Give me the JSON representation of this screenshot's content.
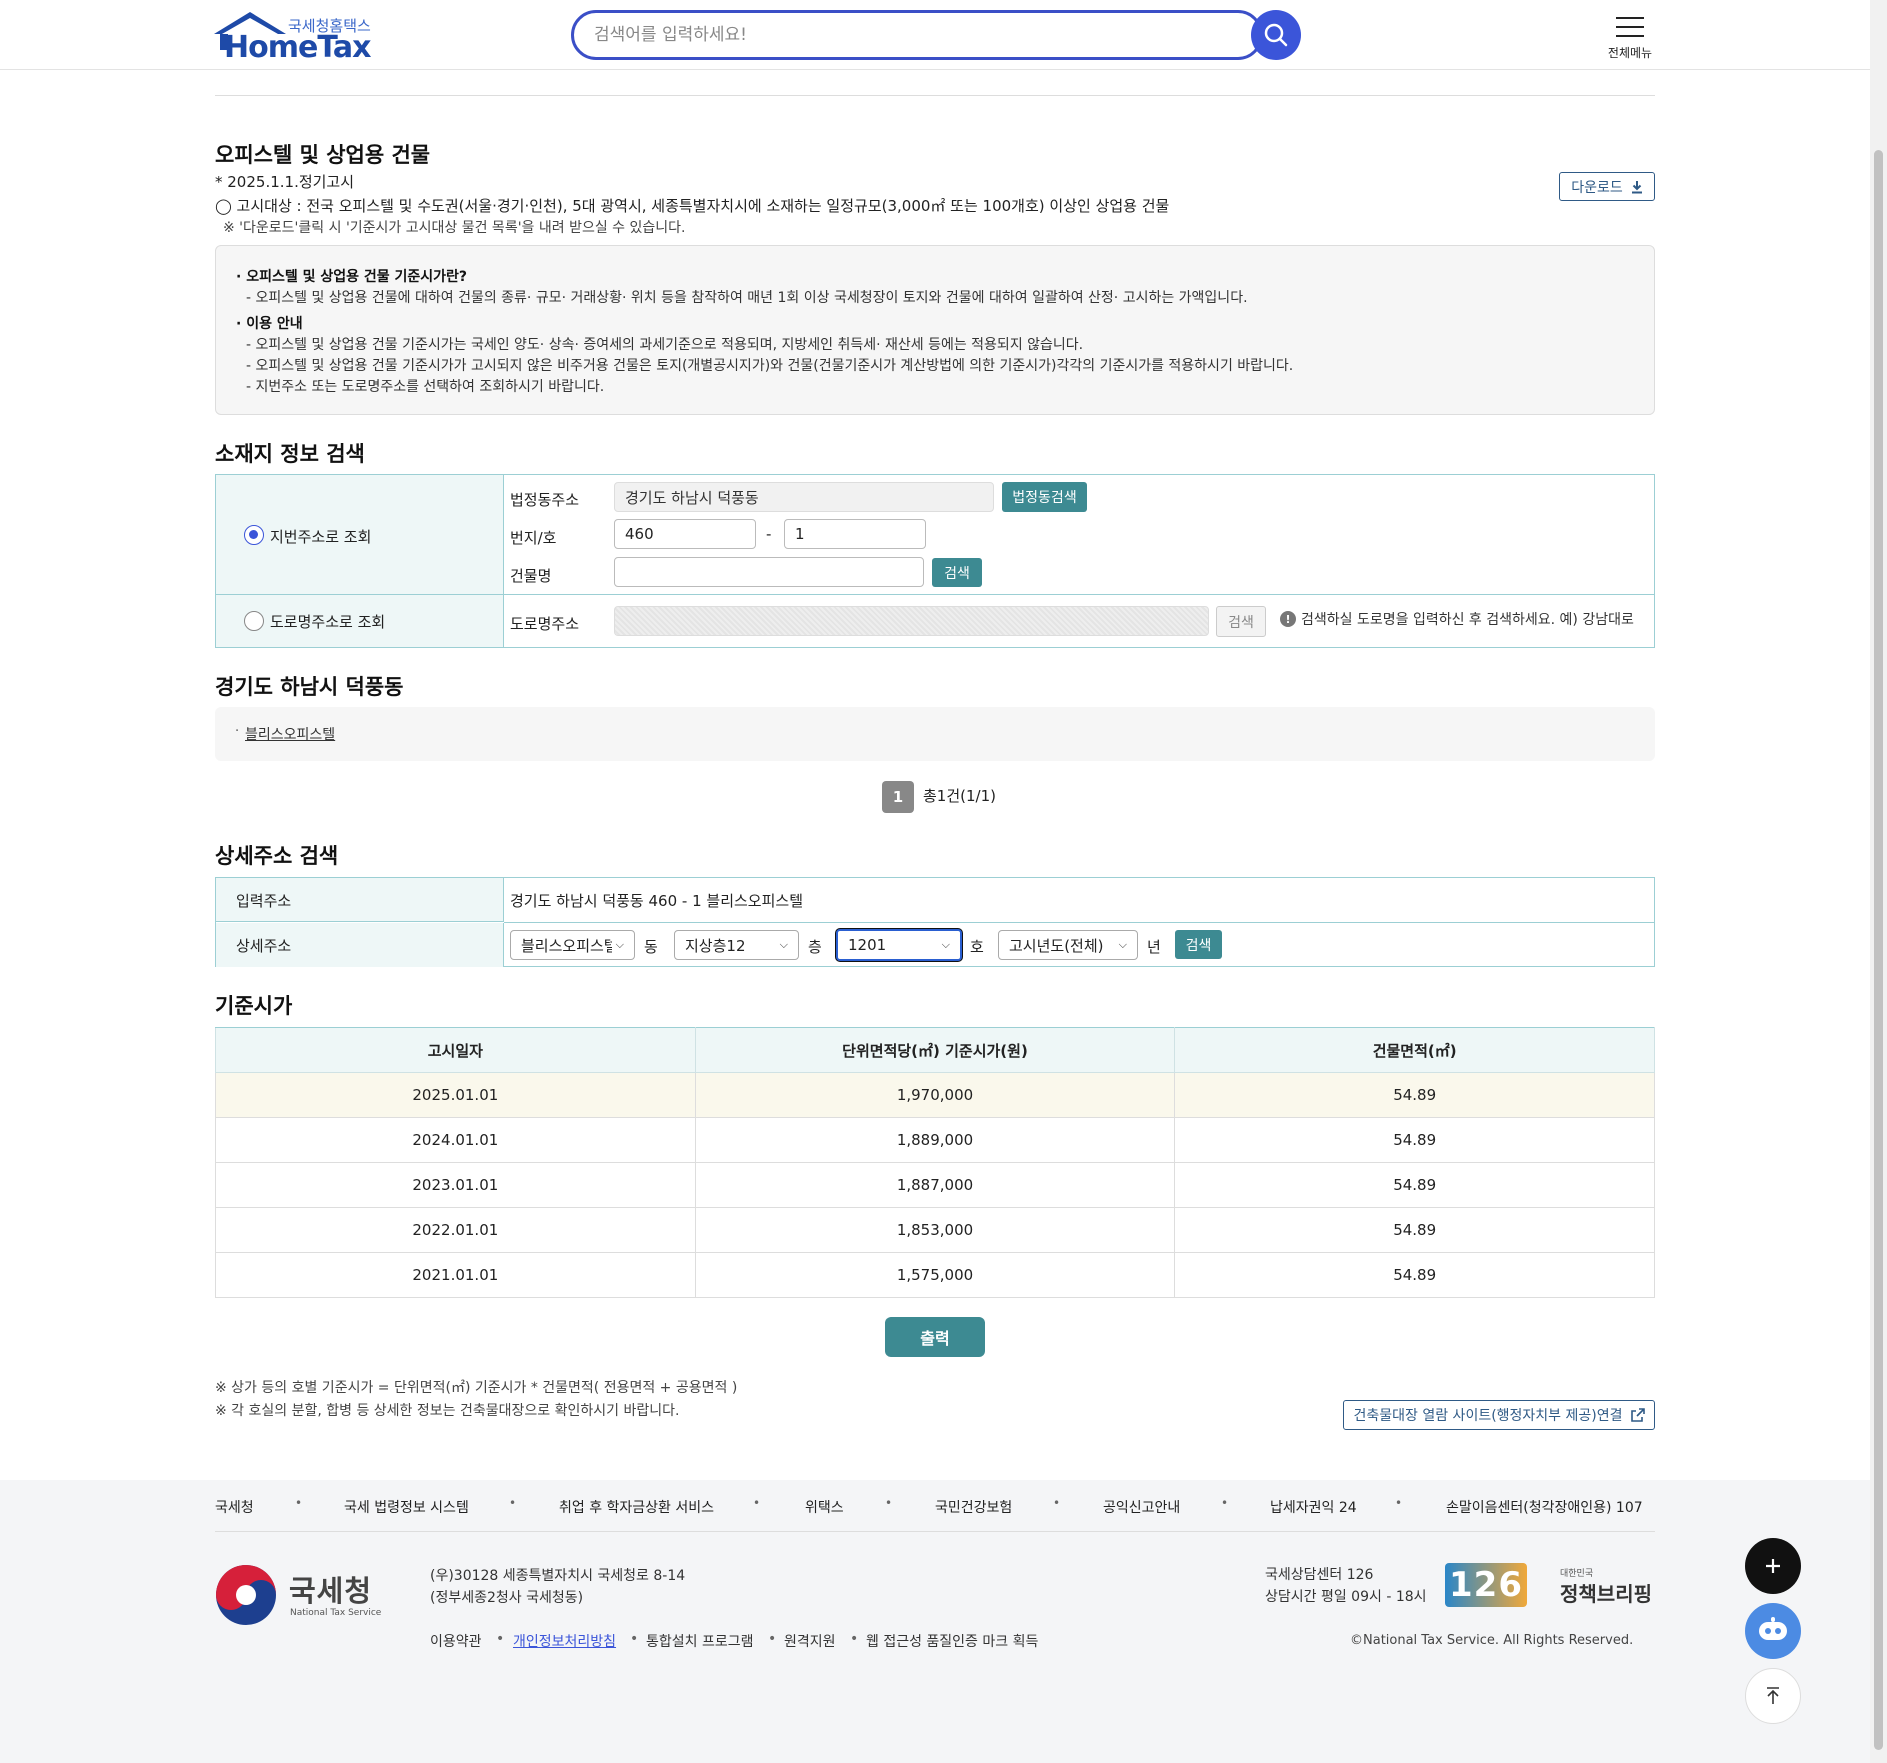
{
  "header": {
    "logo_sub": "국세청홈택스",
    "logo_main": "HomeTax",
    "search_placeholder": "검색어를 입력하세요!",
    "menu_label": "전체메뉴"
  },
  "notice": {
    "title": "오피스텔 및 상업용 건물",
    "date_line": "* 2025.1.1.정기고시",
    "target_line": "◯ 고시대상 : 전국 오피스텔 및 수도권(서울·경기·인천), 5대 광역시, 세종특별자치시에 소재하는 일정규모(3,000㎡ 또는 100개호) 이상인 상업용 건물",
    "download_note": "※ '다운로드'클릭 시 '기준시가 고시대상 물건 목록'을 내려 받으실 수 있습니다.",
    "download_label": "다운로드"
  },
  "info": {
    "h1": "· 오피스텔 및 상업용 건물 기준시가란?",
    "l1": "- 오피스텔 및 상업용 건물에 대하여 건물의 종류· 규모· 거래상황· 위치 등을 참작하여 매년 1회 이상 국세청장이 토지와 건물에 대하여 일괄하여 산정· 고시하는 가액입니다.",
    "h2": "· 이용 안내",
    "l2": "- 오피스텔 및 상업용 건물 기준시가는 국세인 양도· 상속· 증여세의 과세기준으로 적용되며, 지방세인 취득세· 재산세 등에는 적용되지 않습니다.",
    "l3": "- 오피스텔 및 상업용 건물 기준시가가 고시되지 않은 비주거용 건물은 토지(개별공시지가)와 건물(건물기준시가 계산방법에 의한 기준시가)각각의 기준시가를 적용하시기 바랍니다.",
    "l4": "- 지번주소 또는 도로명주소를 선택하여 조회하시기 바랍니다."
  },
  "location_search": {
    "title": "소재지 정보 검색",
    "radio_jibun": "지번주소로 조회",
    "radio_road": "도로명주소로 조회",
    "legal_dong_label": "법정동주소",
    "legal_dong_value": "경기도 하남시 덕풍동",
    "legal_dong_btn": "법정동검색",
    "lot_label": "번지/호",
    "lot_main": "460",
    "lot_sep": "-",
    "lot_sub": "1",
    "building_label": "건물명",
    "building_value": "",
    "search_btn": "검색",
    "road_label": "도로명주소",
    "road_search_btn": "검색",
    "road_hint": "검색하실 도로명을 입력하신 후 검색하세요. 예) 강남대로"
  },
  "results": {
    "title": "경기도 하남시 덕풍동",
    "item": "블리스오피스텔",
    "page": "1",
    "total": "총1건(1/1)"
  },
  "detail_search": {
    "title": "상세주소 검색",
    "input_label": "입력주소",
    "input_value": "경기도 하남시 덕풍동 460 - 1 블리스오피스텔",
    "detail_label": "상세주소",
    "dong_value": "블리스오피스텔",
    "dong_unit": "동",
    "floor_value": "지상층12",
    "floor_unit": "층",
    "ho_value": "1201",
    "ho_unit": "호",
    "year_value": "고시년도(전체)",
    "year_unit": "년",
    "search_btn": "검색"
  },
  "price": {
    "title": "기준시가",
    "headers": [
      "고시일자",
      "단위면적당(㎡) 기준시가(원)",
      "건물면적(㎡)"
    ],
    "rows": [
      [
        "2025.01.01",
        "1,970,000",
        "54.89"
      ],
      [
        "2024.01.01",
        "1,889,000",
        "54.89"
      ],
      [
        "2023.01.01",
        "1,887,000",
        "54.89"
      ],
      [
        "2022.01.01",
        "1,853,000",
        "54.89"
      ],
      [
        "2021.01.01",
        "1,575,000",
        "54.89"
      ]
    ],
    "print_btn": "출력",
    "note1": "※ 상가 등의 호별 기준시가 = 단위면적(㎡) 기준시가 * 건물면적( 전용면적 + 공용면적 )",
    "note2": "※ 각 호실의 분할, 합병 등 상세한 정보는 건축물대장으로 확인하시기 바랍니다.",
    "ext_link": "건축물대장 열람 사이트(행정자치부 제공)연결"
  },
  "footer": {
    "links": [
      "국세청",
      "국세 법령정보 시스템",
      "취업 후 학자금상환 서비스",
      "위택스",
      "국민건강보험",
      "공익신고안내",
      "납세자권익 24",
      "손말이음센터(청각장애인용) 107"
    ],
    "org_name": "국세청",
    "org_en": "National Tax Service",
    "addr1": "(우)30128 세종특별자치시 국세청로 8-14",
    "addr2": "(정부세종2청사 국세청동)",
    "bottom_links": [
      "이용약관",
      "개인정보처리방침",
      "통합설치 프로그램",
      "원격지원",
      "웹 접근성 품질인증 마크 획득"
    ],
    "center_name": "국세상담센터 126",
    "center_hours": "상담시간 평일 09시 - 18시",
    "badge_126": "126",
    "policy_small": "대한민국",
    "policy_name": "정책브리핑",
    "copyright": "©National Tax Service. All Rights Reserved."
  },
  "colors": {
    "brand_blue": "#1e4aa8",
    "search_blue": "#3b55d9",
    "teal": "#3d8a92"
  }
}
